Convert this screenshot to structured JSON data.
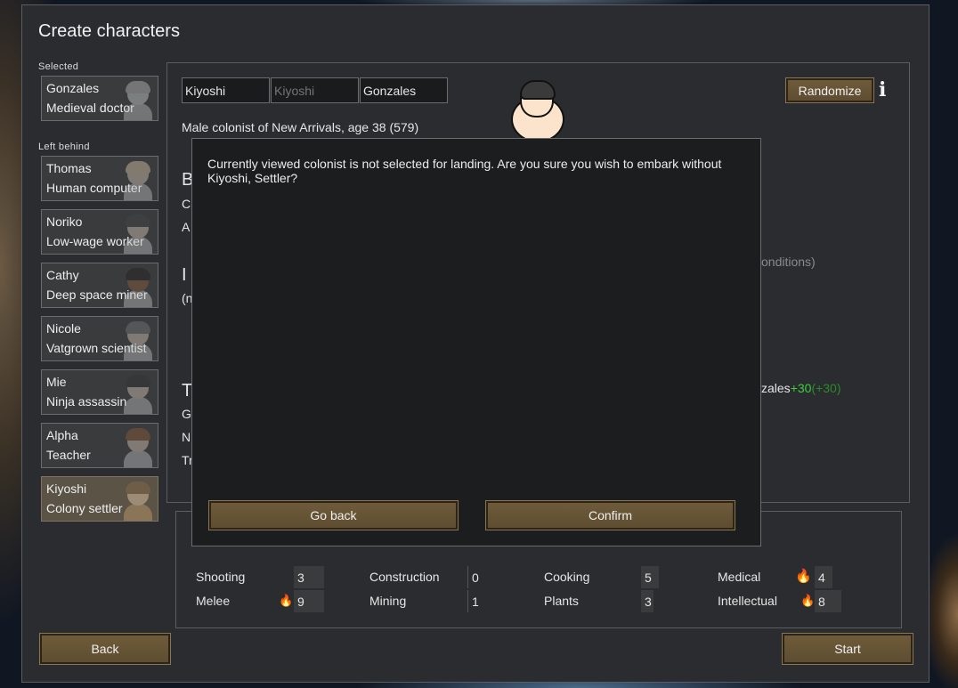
{
  "window": {
    "title": "Create characters"
  },
  "sidebar": {
    "selected_label": "Selected",
    "left_behind_label": "Left behind",
    "selected": [
      {
        "name": "Gonzales",
        "title": "Medieval doctor"
      }
    ],
    "left_behind": [
      {
        "name": "Thomas",
        "title": "Human computer"
      },
      {
        "name": "Noriko",
        "title": "Low-wage worker"
      },
      {
        "name": "Cathy",
        "title": "Deep space miner"
      },
      {
        "name": "Nicole",
        "title": "Vatgrown scientist"
      },
      {
        "name": "Mie",
        "title": "Ninja assassin"
      },
      {
        "name": "Alpha",
        "title": "Teacher"
      },
      {
        "name": "Kiyoshi",
        "title": "Colony settler"
      }
    ]
  },
  "editor": {
    "first_name": "Kiyoshi",
    "nick_name_placeholder": "Kiyoshi",
    "last_name": "Gonzales",
    "description": "Male colonist of New Arrivals, age 38 (579)",
    "randomize_label": "Randomize",
    "fragments": {
      "b": "B",
      "c": "C",
      "a": "A",
      "i": "I",
      "n_paren": "(n",
      "t": "T",
      "g": "G",
      "n": "N",
      "tr": "Tr",
      "conditions": "onditions)",
      "relation_name": "zales",
      "relation_value": "+30",
      "relation_total": "(+30)"
    }
  },
  "skills": [
    {
      "name": "Shooting",
      "value": "3",
      "passion": 0
    },
    {
      "name": "Melee",
      "value": "9",
      "passion": 1
    },
    {
      "name": "Construction",
      "value": "0",
      "passion": 0
    },
    {
      "name": "Mining",
      "value": "1",
      "passion": 0
    },
    {
      "name": "Cooking",
      "value": "5",
      "passion": 0
    },
    {
      "name": "Plants",
      "value": "3",
      "passion": 0
    },
    {
      "name": "Medical",
      "value": "4",
      "passion": 2
    },
    {
      "name": "Intellectual",
      "value": "8",
      "passion": 1
    }
  ],
  "dialog": {
    "message": "Currently viewed colonist is not selected for landing. Are you sure you wish to embark without Kiyoshi, Settler?",
    "go_back_label": "Go back",
    "confirm_label": "Confirm"
  },
  "footer": {
    "back_label": "Back",
    "start_label": "Start"
  },
  "colors": {
    "button": "#6e5b3a",
    "panel": "#2a2c2f",
    "dialog": "#1c1d1f",
    "positive": "#3bd13b"
  },
  "icons": {
    "info": "info-icon",
    "flame": "passion-flame-icon"
  }
}
